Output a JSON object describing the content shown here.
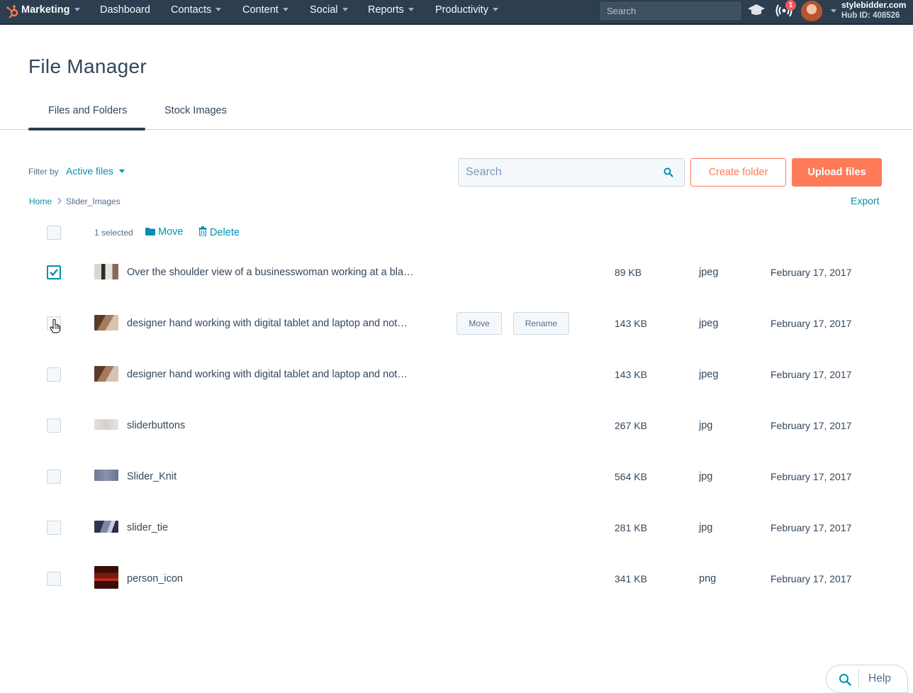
{
  "nav": {
    "items": [
      "Marketing",
      "Dashboard",
      "Contacts",
      "Content",
      "Social",
      "Reports",
      "Productivity"
    ],
    "search_placeholder": "Search",
    "notification_count": "1",
    "account_name": "stylebidder.com",
    "hub_id": "Hub ID: 408526",
    "icons": [
      "hubspot-logo",
      "graduation-cap-icon",
      "notifications-icon",
      "avatar"
    ]
  },
  "page": {
    "title": "File Manager",
    "tabs": [
      "Files and Folders",
      "Stock Images"
    ],
    "active_tab": "Files and Folders"
  },
  "toolbar": {
    "filter_label": "Filter by",
    "filter_value": "Active files",
    "search_placeholder": "Search",
    "create_folder": "Create folder",
    "upload_files": "Upload files",
    "export": "Export"
  },
  "breadcrumb": {
    "home": "Home",
    "current": "Slider_Images"
  },
  "bulk": {
    "selected": "1 selected",
    "move": "Move",
    "delete": "Delete"
  },
  "row_actions": {
    "move": "Move",
    "rename": "Rename"
  },
  "files": [
    {
      "name": "Over the shoulder view of a businesswoman working at a bla…",
      "size": "89 KB",
      "type": "jpeg",
      "date": "February 17, 2017",
      "checked": true,
      "thumb": "office-photo"
    },
    {
      "name": "designer hand working with digital tablet and laptop and not…",
      "size": "143 KB",
      "type": "jpeg",
      "date": "February 17, 2017",
      "checked": false,
      "thumb": "desk-photo"
    },
    {
      "name": "designer hand working with digital tablet and laptop and not…",
      "size": "143 KB",
      "type": "jpeg",
      "date": "February 17, 2017",
      "checked": false,
      "thumb": "desk-photo"
    },
    {
      "name": "sliderbuttons",
      "size": "267 KB",
      "type": "jpg",
      "date": "February 17, 2017",
      "checked": false,
      "thumb": "light-texture"
    },
    {
      "name": "Slider_Knit",
      "size": "564 KB",
      "type": "jpg",
      "date": "February 17, 2017",
      "checked": false,
      "thumb": "knit-texture"
    },
    {
      "name": "slider_tie",
      "size": "281 KB",
      "type": "jpg",
      "date": "February 17, 2017",
      "checked": false,
      "thumb": "tie-photo"
    },
    {
      "name": "person_icon",
      "size": "341 KB",
      "type": "png",
      "date": "February 17, 2017",
      "checked": false,
      "thumb": "red-banner"
    }
  ],
  "help": {
    "label": "Help"
  },
  "colors": {
    "nav_bg": "#2d3e50",
    "accent_orange": "#ff7a59",
    "link_teal": "#0091ae",
    "text_dark": "#33475b"
  }
}
